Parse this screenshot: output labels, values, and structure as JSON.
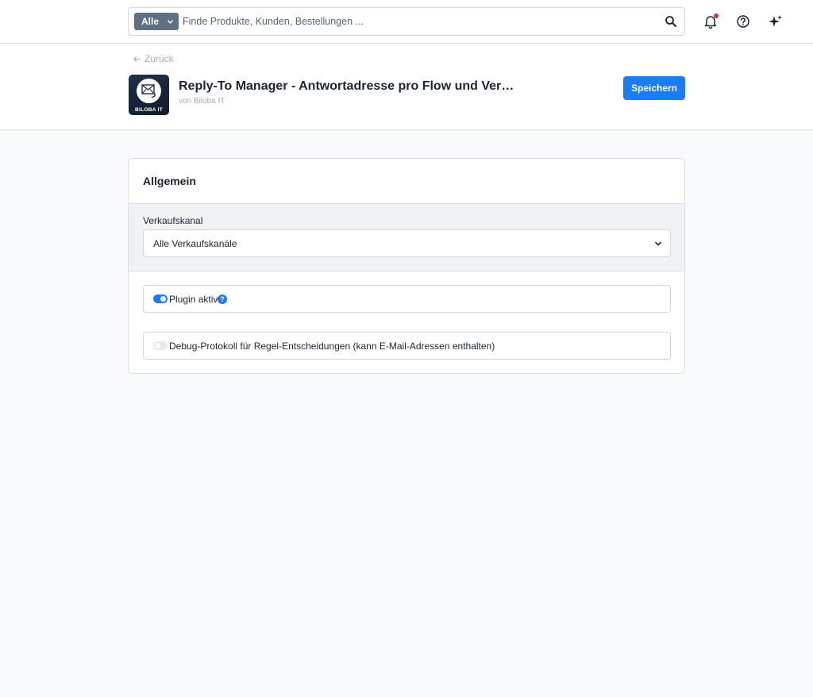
{
  "search": {
    "type_label": "Alle",
    "placeholder": "Finde Produkte, Kunden, Bestellungen ..."
  },
  "header": {
    "back_label": "Zurück",
    "plugin_title": "Reply-To Manager - Antwortadresse pro Flow und Verkaufskanal",
    "plugin_vendor": "von Biloba IT",
    "plugin_logo_text": "BILOBA IT",
    "save_label": "Speichern"
  },
  "card": {
    "title": "Allgemein",
    "channel_label": "Verkaufskanal",
    "channel_value": "Alle Verkaufskanäle",
    "fields": [
      {
        "label": "Plugin aktiv",
        "enabled": true,
        "help": "?"
      },
      {
        "label": "Debug-Protokoll für Regel-Entscheidungen (kann E-Mail-Adressen enthalten)",
        "enabled": false
      }
    ]
  },
  "colors": {
    "primary": "#1a7df5",
    "notification_dot": "#de294c",
    "search_type_bg": "#5f7084",
    "page_bg": "#f9fafc"
  },
  "icons": [
    "search-icon",
    "bell-icon",
    "help-circle-icon",
    "sparkles-icon",
    "arrow-left-icon",
    "chevron-down-icon",
    "mail-reply-icon"
  ]
}
